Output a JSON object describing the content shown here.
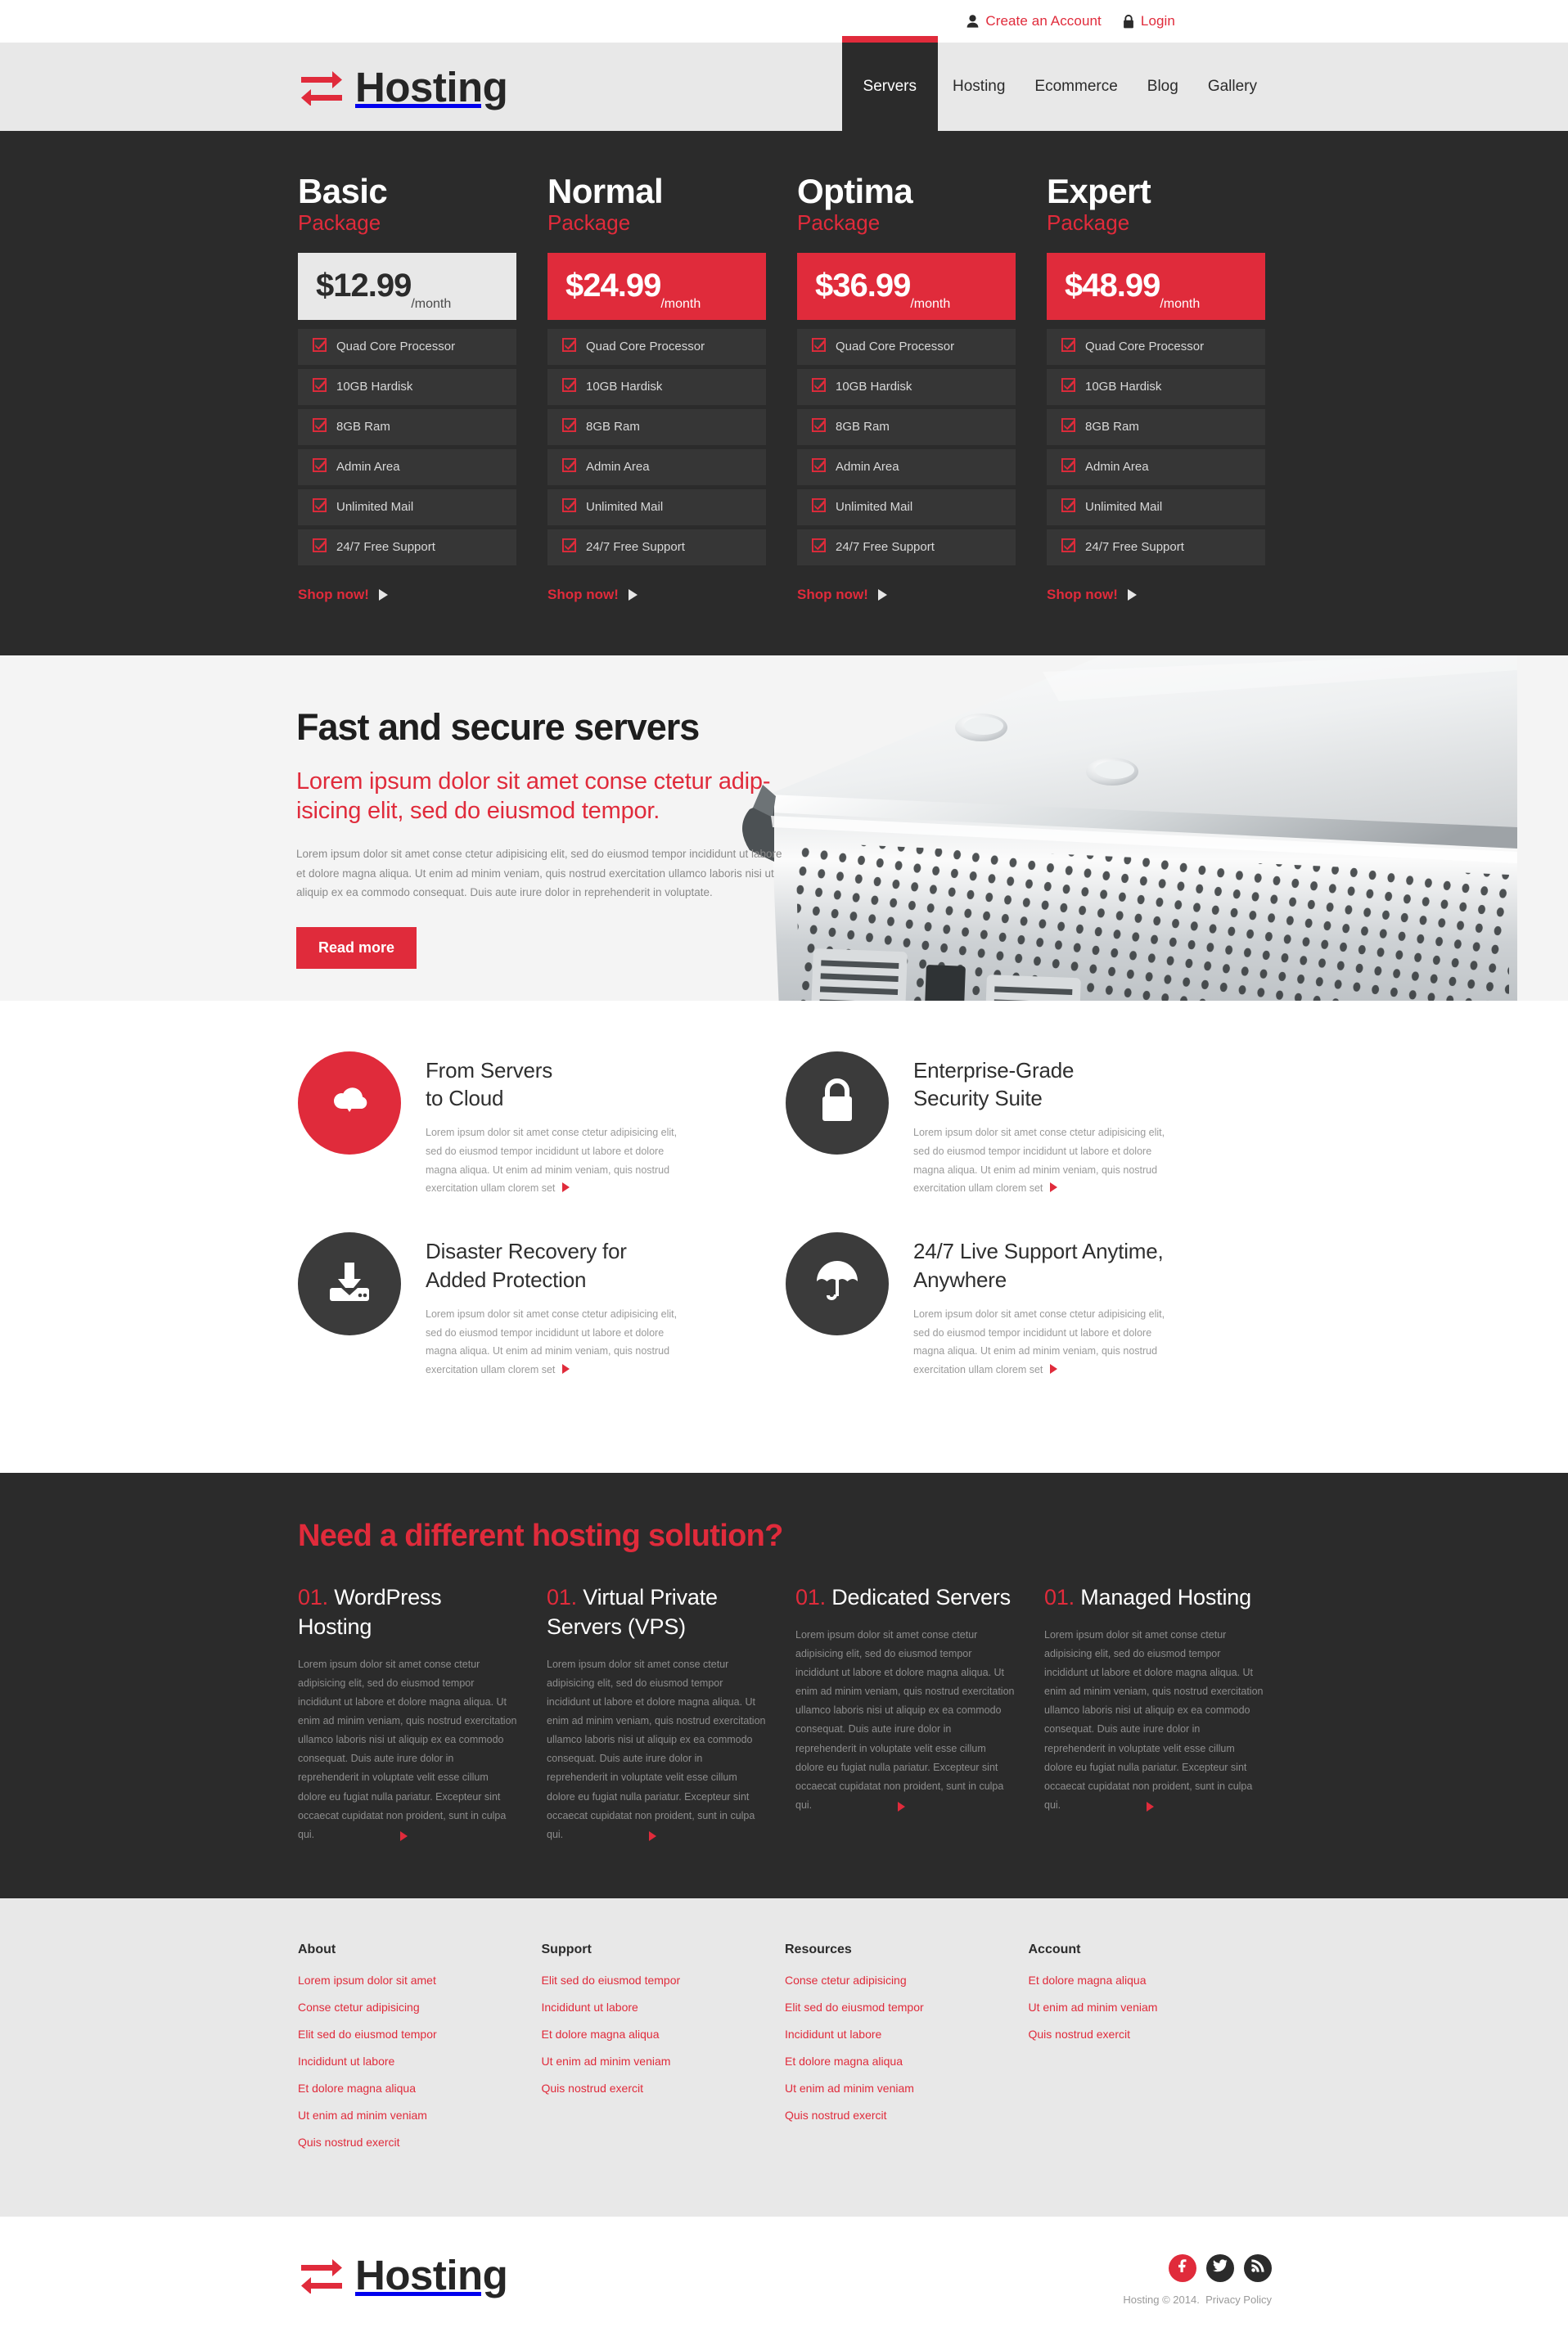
{
  "topbar": {
    "create_account": "Create an Account",
    "login": "Login"
  },
  "header": {
    "logo_text": "Hosting",
    "nav": [
      {
        "label": "Servers",
        "active": true
      },
      {
        "label": "Hosting",
        "active": false
      },
      {
        "label": "Ecommerce",
        "active": false
      },
      {
        "label": "Blog",
        "active": false
      },
      {
        "label": "Gallery",
        "active": false
      }
    ]
  },
  "pricing": {
    "shop_label": "Shop now!",
    "per_month": "/month",
    "plans": [
      {
        "name": "Basic",
        "sub": "Package",
        "price": "$12.99",
        "highlight": false,
        "features": [
          "Quad Core Processor",
          "10GB Hardisk",
          "8GB Ram",
          "Admin Area",
          "Unlimited Mail",
          "24/7 Free Support"
        ]
      },
      {
        "name": "Normal",
        "sub": "Package",
        "price": "$24.99",
        "highlight": true,
        "features": [
          "Quad Core Processor",
          "10GB Hardisk",
          "8GB Ram",
          "Admin Area",
          "Unlimited Mail",
          "24/7 Free Support"
        ]
      },
      {
        "name": "Optima",
        "sub": "Package",
        "price": "$36.99",
        "highlight": true,
        "features": [
          "Quad Core Processor",
          "10GB Hardisk",
          "8GB Ram",
          "Admin Area",
          "Unlimited Mail",
          "24/7 Free Support"
        ]
      },
      {
        "name": "Expert",
        "sub": "Package",
        "price": "$48.99",
        "highlight": true,
        "features": [
          "Quad Core Processor",
          "10GB Hardisk",
          "8GB Ram",
          "Admin Area",
          "Unlimited Mail",
          "24/7 Free Support"
        ]
      }
    ]
  },
  "hero": {
    "title": "Fast and secure servers",
    "lead": "Lorem ipsum dolor sit amet conse ctetur adip-isicing elit, sed do eiusmod tempor.",
    "body": "Lorem ipsum dolor sit amet conse ctetur adipisicing elit, sed do eiusmod tempor incididunt ut labore et dolore magna aliqua. Ut enim ad minim veniam, quis nostrud exercitation ullamco laboris nisi ut aliquip ex ea commodo consequat. Duis aute irure dolor in reprehenderit in voluptate.",
    "button": "Read more"
  },
  "features": {
    "body_text": "Lorem ipsum dolor sit amet conse ctetur adipisicing elit, sed do eiusmod tempor incididunt ut labore et dolore magna aliqua. Ut enim ad minim veniam, quis nostrud exercitation ullam clorem set",
    "items": [
      {
        "title": "From Servers\nto Cloud",
        "icon": "cloud-download-icon",
        "circle": "red"
      },
      {
        "title": "Enterprise-Grade\nSecurity Suite",
        "icon": "lock-icon",
        "circle": "dark"
      },
      {
        "title": "Disaster Recovery for\nAdded Protection",
        "icon": "download-inbox-icon",
        "circle": "dark"
      },
      {
        "title": "24/7 Live Support Anytime,\nAnywhere",
        "icon": "umbrella-icon",
        "circle": "dark"
      }
    ]
  },
  "solutions": {
    "title": "Need a different hosting solution?",
    "body_text": "Lorem ipsum dolor sit amet conse ctetur adipisicing elit, sed do eiusmod tempor incididunt ut labore et dolore magna aliqua. Ut enim ad minim veniam, quis nostrud exercitation ullamco laboris nisi ut aliquip ex ea commodo consequat. Duis aute irure dolor in reprehenderit in voluptate velit esse cillum dolore eu fugiat nulla pariatur. Excepteur sint occaecat cupidatat non proident, sunt in culpa qui.",
    "items": [
      {
        "num": "01.",
        "title": "WordPress Hosting"
      },
      {
        "num": "01.",
        "title": "Virtual Private Servers (VPS)"
      },
      {
        "num": "01.",
        "title": "Dedicated Servers"
      },
      {
        "num": "01.",
        "title": "Managed Hosting"
      }
    ]
  },
  "footer": {
    "columns": [
      {
        "heading": "About",
        "links": [
          "Lorem ipsum dolor sit amet",
          "Conse ctetur adipisicing",
          "Elit sed do eiusmod tempor",
          "Incididunt ut labore",
          "Et dolore magna aliqua",
          "Ut enim ad minim veniam",
          "Quis nostrud exercit"
        ]
      },
      {
        "heading": "Support",
        "links": [
          "Elit sed do eiusmod tempor",
          "Incididunt ut labore",
          "Et dolore magna aliqua",
          "Ut enim ad minim veniam",
          "Quis nostrud exercit"
        ]
      },
      {
        "heading": "Resources",
        "links": [
          "Conse ctetur adipisicing",
          "Elit sed do eiusmod tempor",
          "Incididunt ut labore",
          "Et dolore magna aliqua",
          "Ut enim ad minim veniam",
          "Quis nostrud exercit"
        ]
      },
      {
        "heading": "Account",
        "links": [
          "Et dolore magna aliqua",
          "Ut enim ad minim veniam",
          "Quis nostrud exercit"
        ]
      }
    ]
  },
  "bottom": {
    "logo_text": "Hosting",
    "copyright": "Hosting © 2014.",
    "privacy": "Privacy Policy",
    "social": [
      "facebook-icon",
      "twitter-icon",
      "rss-icon"
    ]
  },
  "colors": {
    "accent": "#e02b3b",
    "dark": "#2b2b2b",
    "light": "#e8e8e8",
    "hero_bg": "#f4f4f4"
  }
}
